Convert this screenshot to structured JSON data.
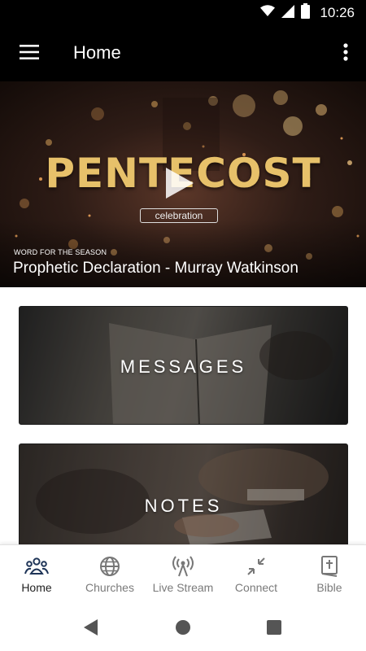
{
  "status_bar": {
    "time": "10:26"
  },
  "app_bar": {
    "title": "Home"
  },
  "hero": {
    "title": "PENTECOST",
    "logo_text": "celebration",
    "kicker": "WORD FOR THE SEASON",
    "caption": "Prophetic Declaration - Murray Watkinson"
  },
  "cards": [
    {
      "label": "MESSAGES"
    },
    {
      "label": "NOTES"
    }
  ],
  "bottom_nav": {
    "active": "Home",
    "items": [
      {
        "label": "Home",
        "icon": "people-icon"
      },
      {
        "label": "Churches",
        "icon": "globe-icon"
      },
      {
        "label": "Live Stream",
        "icon": "antenna-icon"
      },
      {
        "label": "Connect",
        "icon": "collapse-arrows-icon"
      },
      {
        "label": "Bible",
        "icon": "bible-icon"
      }
    ]
  },
  "colors": {
    "app_bar": "#000000",
    "hero_title": "#e7c16a",
    "nav_active": "#222222",
    "nav_inactive": "#7a7a7a"
  }
}
